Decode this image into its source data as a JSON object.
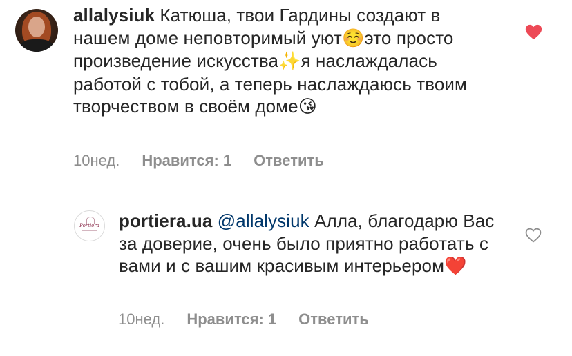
{
  "comments": [
    {
      "username": "allalysiuk",
      "text_parts": {
        "t1": " Катюша, твои Гардины создают в нашем доме неповторимый уют",
        "e1": "☺️",
        "t2": "это просто произведение искусства",
        "e2": "✨",
        "t3": "я наслаждалась работой с тобой, а теперь наслаждаюсь твоим творчеством в своём доме",
        "e3": "😘"
      },
      "time": "10нед.",
      "likes": "Нравится: 1",
      "reply": "Ответить",
      "liked": true,
      "heart_icon": "heart-filled-icon",
      "heart_color": "#ed4956"
    },
    {
      "username": "portiera.ua",
      "avatar_text": "Portiera",
      "text_parts": {
        "mention": "@allalysiuk",
        "t1": " Алла, благодарю Вас за доверие, очень было приятно работать с вами и с вашим красивым интерьером",
        "e1": "❤️"
      },
      "time": "10нед.",
      "likes": "Нравится: 1",
      "reply": "Ответить",
      "liked": false,
      "heart_icon": "heart-outline-icon",
      "heart_color": "#8e8e8e"
    }
  ],
  "colors": {
    "text": "#262626",
    "meta": "#8e8e8e",
    "mention": "#00376b",
    "like_red": "#ed4956"
  }
}
